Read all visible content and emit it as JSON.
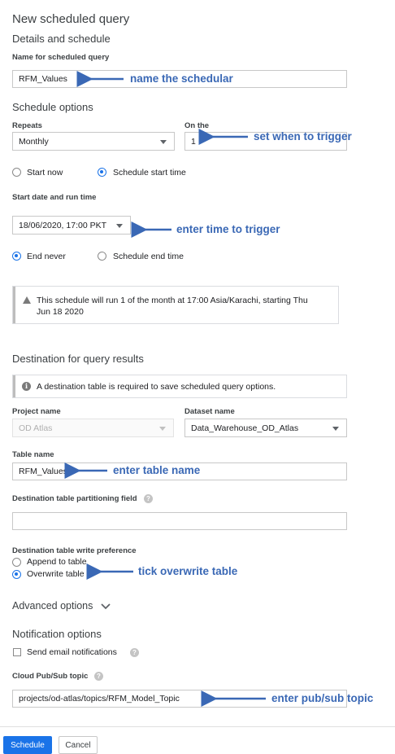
{
  "page_title": "New scheduled query",
  "section_details": "Details and schedule",
  "name_field": {
    "label": "Name for scheduled query",
    "value": "RFM_Values"
  },
  "schedule_options": {
    "heading": "Schedule options",
    "repeats_label": "Repeats",
    "repeats_value": "Monthly",
    "on_the_label": "On the",
    "on_the_value": "1",
    "start_now": "Start now",
    "schedule_start_time": "Schedule start time",
    "start_date_label": "Start date and run time",
    "start_date_value": "18/06/2020, 17:00 PKT",
    "end_never": "End never",
    "schedule_end_time": "Schedule end time",
    "info_text": "This schedule will run 1 of the month at 17:00 Asia/Karachi, starting Thu Jun 18 2020"
  },
  "destination": {
    "heading": "Destination for query results",
    "info_text": "A destination table is required to save scheduled query options.",
    "project_label": "Project name",
    "project_value": "OD Atlas",
    "dataset_label": "Dataset name",
    "dataset_value": "Data_Warehouse_OD_Atlas",
    "table_label": "Table name",
    "table_value": "RFM_Values",
    "partition_label": "Destination table partitioning field",
    "partition_value": "",
    "write_pref_label": "Destination table write preference",
    "append": "Append to table",
    "overwrite": "Overwrite table"
  },
  "advanced_options": "Advanced options",
  "notification": {
    "heading": "Notification options",
    "email": "Send email notifications",
    "pubsub_label": "Cloud Pub/Sub topic",
    "pubsub_value": "projects/od-atlas/topics/RFM_Model_Topic"
  },
  "buttons": {
    "schedule": "Schedule",
    "cancel": "Cancel"
  },
  "annotations": {
    "name": "name  the schedular",
    "trigger": "set when to trigger",
    "time": "enter time to trigger",
    "table": "enter table name",
    "overwrite": "tick overwrite table",
    "pubsub": "enter pub/sub topic"
  },
  "colors": {
    "accent": "#1a73e8",
    "annotation": "#3a68b5",
    "border": "#c8c8c8"
  }
}
